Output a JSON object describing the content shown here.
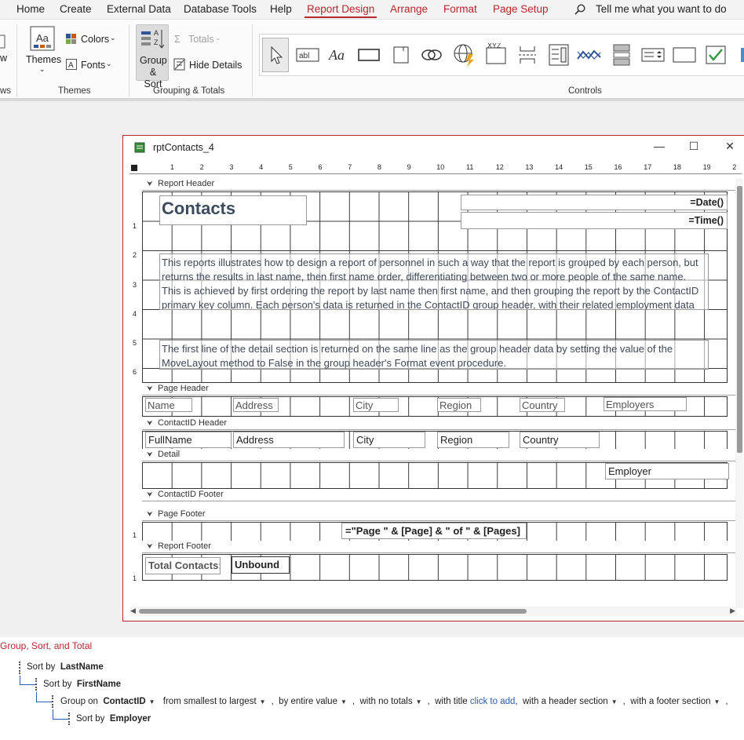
{
  "ribbon": {
    "tabs": [
      "Home",
      "Create",
      "External Data",
      "Database Tools",
      "Help",
      "Report Design",
      "Arrange",
      "Format",
      "Page Setup"
    ],
    "active_tab": "Report Design",
    "tell_me": "Tell me what you want to do",
    "themes_label": "Themes",
    "colors_label": "Colors",
    "fonts_label": "Fonts",
    "group_sort_label": "Group & Sort",
    "totals_label": "Totals",
    "hide_details_label": "Hide Details",
    "left_cut_label": "w",
    "left_cut_group": "ws",
    "group_labels": {
      "themes": "Themes",
      "grouping": "Grouping & Totals",
      "controls": "Controls"
    },
    "controls_icons": [
      "select-pointer-icon",
      "textbox-icon",
      "label-icon",
      "button-icon",
      "tab-control-icon",
      "hyperlink-icon",
      "web-browser-icon",
      "navigation-control-icon",
      "option-group-icon",
      "page-break-icon",
      "combo-box-icon",
      "line-chart-icon",
      "list-box-icon",
      "rectangle-icon",
      "checkbox-icon",
      "more-icon"
    ],
    "colors": {
      "accent": "#b7282e",
      "link": "#2a5db0"
    }
  },
  "window": {
    "title": "rptContacts_4",
    "ruler_numbers": [
      "1",
      "2",
      "3",
      "4",
      "5",
      "6",
      "7",
      "8",
      "9",
      "10",
      "11",
      "12",
      "13",
      "14",
      "15",
      "16",
      "17",
      "18",
      "19",
      "2"
    ],
    "vruler_numbers": [
      "1",
      "2",
      "3",
      "4",
      "5",
      "6",
      "1",
      "1"
    ]
  },
  "report": {
    "sections": {
      "report_header": "Report Header",
      "page_header": "Page Header",
      "contactid_header": "ContactID Header",
      "detail": "Detail",
      "contactid_footer": "ContactID Footer",
      "page_footer": "Page Footer",
      "report_footer": "Report Footer"
    },
    "title": "Contacts",
    "date_expr": "=Date()",
    "time_expr": "=Time()",
    "description_1": "This reports illustrates how to design a report of personnel in such a way that the report is grouped by each person, but returns the results in last name, then first name order, differentiating between two or more people of the same name.  This is achieved by first ordering the report by last name then first name, and then grouping the report by the ContactID primary key column.  Each person's data is returned in the ContactID group header, with their related employment data being returned in the detail section.",
    "description_2": "The first line of the detail section is returned on the same line as the group header data by setting the value of the MoveLayout method to False in the group header's Format event procedure.",
    "page_header_labels": [
      "Name",
      "Address",
      "City",
      "Region",
      "Country",
      "Employers"
    ],
    "group_header_fields": [
      "FullName",
      "Address",
      "City",
      "Region",
      "Country"
    ],
    "detail_field": "Employer",
    "page_footer_expr": "=\"Page \" & [Page] & \" of \" & [Pages]",
    "total_label": "Total Contacts:",
    "total_value": "Unbound"
  },
  "gst": {
    "title": "Group, Sort, and Total",
    "sort_by": "Sort by",
    "group_on": "Group on",
    "sort1_field": "LastName",
    "sort2_field": "FirstName",
    "group_field": "ContactID",
    "order": "from smallest to largest",
    "by_value": "by entire value",
    "totals": "with no totals",
    "with_title": "with title",
    "click_to_add": "click to add",
    "header_section": "with a header section",
    "footer_section": "with a footer section",
    "sort3_field": "Employer"
  }
}
